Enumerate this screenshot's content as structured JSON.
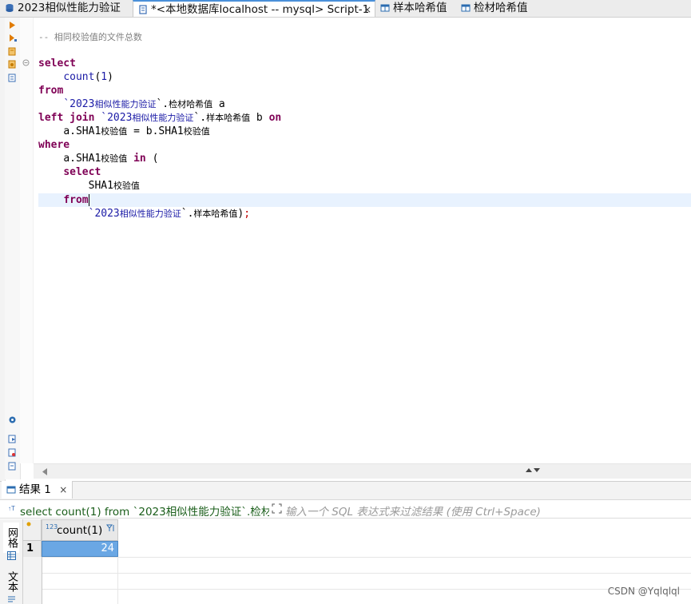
{
  "tabs": [
    {
      "label": "2023相似性能力验证",
      "icon": "database-icon"
    },
    {
      "label": "*<本地数据库localhost -- mysql> Script-1",
      "icon": "sql-script-icon",
      "active": true,
      "close": "×"
    },
    {
      "label": "样本哈希值",
      "icon": "table-icon"
    },
    {
      "label": "检材哈希值",
      "icon": "table-icon"
    }
  ],
  "editor": {
    "comment": "-- 相同校验值的文件总数",
    "kw_select": "select",
    "fn_count": "count",
    "paren_open": "(",
    "num_one": "1",
    "paren_close": ")",
    "kw_from": "from",
    "db1": "`2023",
    "db1_cjk": "相似性能力验证",
    "tbl1_sep": "`.",
    "tbl1_cjk": "检材哈希值",
    "alias_a": " a",
    "kw_left_join": "left join",
    "db2": " `2023",
    "db2_cjk": "相似性能力验证",
    "tbl2_sep": "`.",
    "tbl2_cjk": "样本哈希值",
    "alias_b": " b ",
    "kw_on": "on",
    "on_left": "a.SHA1",
    "on_left_cjk": "校验值",
    "on_eq": " = b.SHA1",
    "on_right_cjk": "校验值",
    "kw_where": "where",
    "where_col": "a.SHA1",
    "where_col_cjk": "校验值",
    "kw_in": "in",
    "paren_in": " (",
    "kw_select2": "select",
    "sub_col": "SHA1",
    "sub_col_cjk": "校验值",
    "kw_from2": "from",
    "db3": "`2023",
    "db3_cjk": "相似性能力验证",
    "tbl3_sep": "`.",
    "tbl3_cjk": "样本哈希值",
    "tail": ")",
    "semi": ";"
  },
  "results": {
    "tab_label": "结果 1",
    "tab_close": "×",
    "query_text": "select count(1) from `2023相似性能力验证`.检材哈",
    "filter_placeholder": "输入一个 SQL 表达式来过滤结果 (使用 Ctrl+Space)",
    "side_tabs": [
      "网格",
      "文本"
    ],
    "column_type": "123",
    "column_header": "count(1)",
    "rows": [
      {
        "index": "1",
        "value": "24"
      }
    ]
  },
  "watermark": "CSDN @Yqlqlql"
}
